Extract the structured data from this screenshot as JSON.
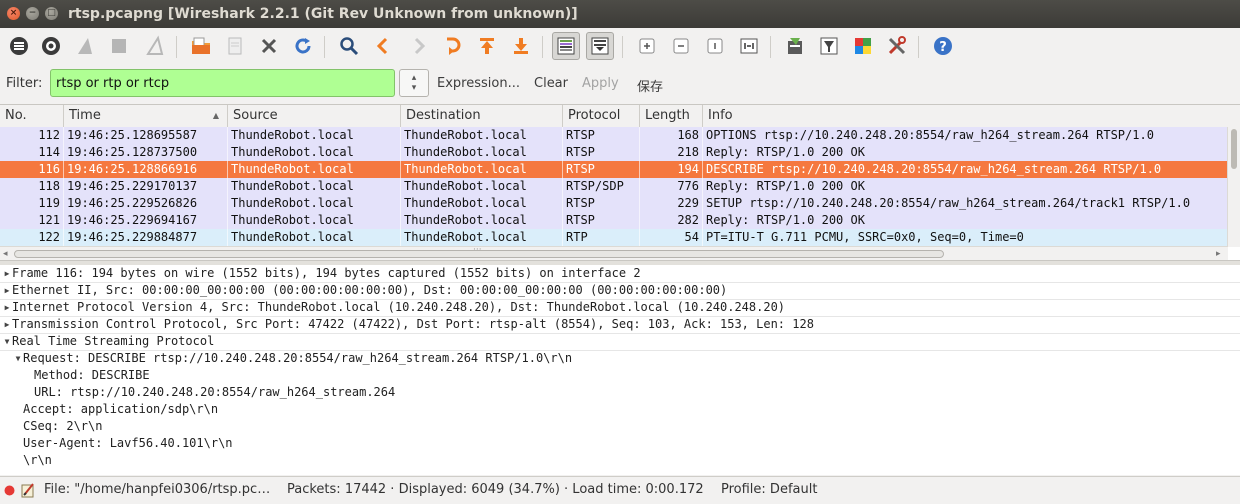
{
  "window": {
    "title": "rtsp.pcapng [Wireshark 2.2.1 (Git Rev Unknown from unknown)]",
    "close_glyph": "×",
    "min_glyph": "−",
    "max_glyph": "□"
  },
  "filter": {
    "label": "Filter:",
    "value": "rtsp or rtp or rtcp",
    "expression_label": "Expression...",
    "clear_label": "Clear",
    "apply_label": "Apply",
    "save_label": "保存",
    "valid_color": "#afff93"
  },
  "packet_list": {
    "columns": [
      "No.",
      "Time",
      "Source",
      "Destination",
      "Protocol",
      "Length",
      "Info"
    ],
    "sort_indicator": "▲",
    "selected_color": "#f5783f",
    "rows": [
      {
        "no": "112",
        "time": "19:46:25.128695587",
        "source": "ThundeRobot.local",
        "destination": "ThundeRobot.local",
        "protocol": "RTSP",
        "length": "168",
        "info": "OPTIONS rtsp://10.240.248.20:8554/raw_h264_stream.264 RTSP/1.0",
        "bg": "#e4e2fa"
      },
      {
        "no": "114",
        "time": "19:46:25.128737500",
        "source": "ThundeRobot.local",
        "destination": "ThundeRobot.local",
        "protocol": "RTSP",
        "length": "218",
        "info": "Reply: RTSP/1.0 200 OK",
        "bg": "#e4e2fa"
      },
      {
        "no": "116",
        "time": "19:46:25.128866916",
        "source": "ThundeRobot.local",
        "destination": "ThundeRobot.local",
        "protocol": "RTSP",
        "length": "194",
        "info": "DESCRIBE rtsp://10.240.248.20:8554/raw_h264_stream.264 RTSP/1.0",
        "bg": "#f5783f"
      },
      {
        "no": "118",
        "time": "19:46:25.229170137",
        "source": "ThundeRobot.local",
        "destination": "ThundeRobot.local",
        "protocol": "RTSP/SDP",
        "length": "776",
        "info": "Reply: RTSP/1.0 200 OK",
        "bg": "#e4e2fa"
      },
      {
        "no": "119",
        "time": "19:46:25.229526826",
        "source": "ThundeRobot.local",
        "destination": "ThundeRobot.local",
        "protocol": "RTSP",
        "length": "229",
        "info": "SETUP rtsp://10.240.248.20:8554/raw_h264_stream.264/track1 RTSP/1.0",
        "bg": "#e4e2fa"
      },
      {
        "no": "121",
        "time": "19:46:25.229694167",
        "source": "ThundeRobot.local",
        "destination": "ThundeRobot.local",
        "protocol": "RTSP",
        "length": "282",
        "info": "Reply: RTSP/1.0 200 OK",
        "bg": "#e4e2fa"
      },
      {
        "no": "122",
        "time": "19:46:25.229884877",
        "source": "ThundeRobot.local",
        "destination": "ThundeRobot.local",
        "protocol": "RTP",
        "length": "54",
        "info": "PT=ITU-T G.711 PCMU, SSRC=0x0, Seq=0, Time=0",
        "bg": "#daeefa"
      }
    ]
  },
  "scroll": {
    "left_arrow": "◂",
    "right_arrow": "▸",
    "dots": "···"
  },
  "details": {
    "collapsed_glyph": "▶",
    "expanded_glyph": "▼",
    "lines": [
      {
        "text": "Frame 116: 194 bytes on wire (1552 bits), 194 bytes captured (1552 bits) on interface 2",
        "state": "collapsed"
      },
      {
        "text": "Ethernet II, Src: 00:00:00_00:00:00 (00:00:00:00:00:00), Dst: 00:00:00_00:00:00 (00:00:00:00:00:00)",
        "state": "collapsed"
      },
      {
        "text": "Internet Protocol Version 4, Src: ThundeRobot.local (10.240.248.20), Dst: ThundeRobot.local (10.240.248.20)",
        "state": "collapsed"
      },
      {
        "text": "Transmission Control Protocol, Src Port: 47422 (47422), Dst Port: rtsp-alt (8554), Seq: 103, Ack: 153, Len: 128",
        "state": "collapsed"
      },
      {
        "text": "Real Time Streaming Protocol",
        "state": "expanded"
      },
      {
        "text": "Request: DESCRIBE rtsp://10.240.248.20:8554/raw_h264_stream.264 RTSP/1.0\\r\\n",
        "state": "expanded"
      },
      {
        "text": "Method: DESCRIBE",
        "state": "leaf"
      },
      {
        "text": "URL: rtsp://10.240.248.20:8554/raw_h264_stream.264",
        "state": "leaf"
      },
      {
        "text": "Accept: application/sdp\\r\\n",
        "state": "leaf"
      },
      {
        "text": "CSeq: 2\\r\\n",
        "state": "leaf"
      },
      {
        "text": "User-Agent: Lavf56.40.101\\r\\n",
        "state": "leaf"
      },
      {
        "text": "\\r\\n",
        "state": "leaf"
      }
    ]
  },
  "status": {
    "file": "File: \"/home/hanpfei0306/rtsp.pc…",
    "packets": "Packets: 17442 · Displayed: 6049 (34.7%) · Load time: 0:00.172",
    "profile": "Profile: Default"
  },
  "toolbar_icons": [
    "interfaces-icon",
    "options-icon",
    "start-capture-icon",
    "stop-capture-icon",
    "restart-capture-icon",
    "open-file-icon",
    "save-file-icon",
    "close-file-icon",
    "reload-icon",
    "find-icon",
    "back-icon",
    "forward-icon",
    "go-to-packet-icon",
    "first-packet-icon",
    "last-packet-icon",
    "colorize-icon",
    "autoscroll-icon",
    "zoom-in-icon",
    "zoom-out-icon",
    "normal-size-icon",
    "resize-columns-icon",
    "capture-filters-icon",
    "display-filters-icon",
    "coloring-rules-icon",
    "preferences-icon",
    "help-icon"
  ]
}
